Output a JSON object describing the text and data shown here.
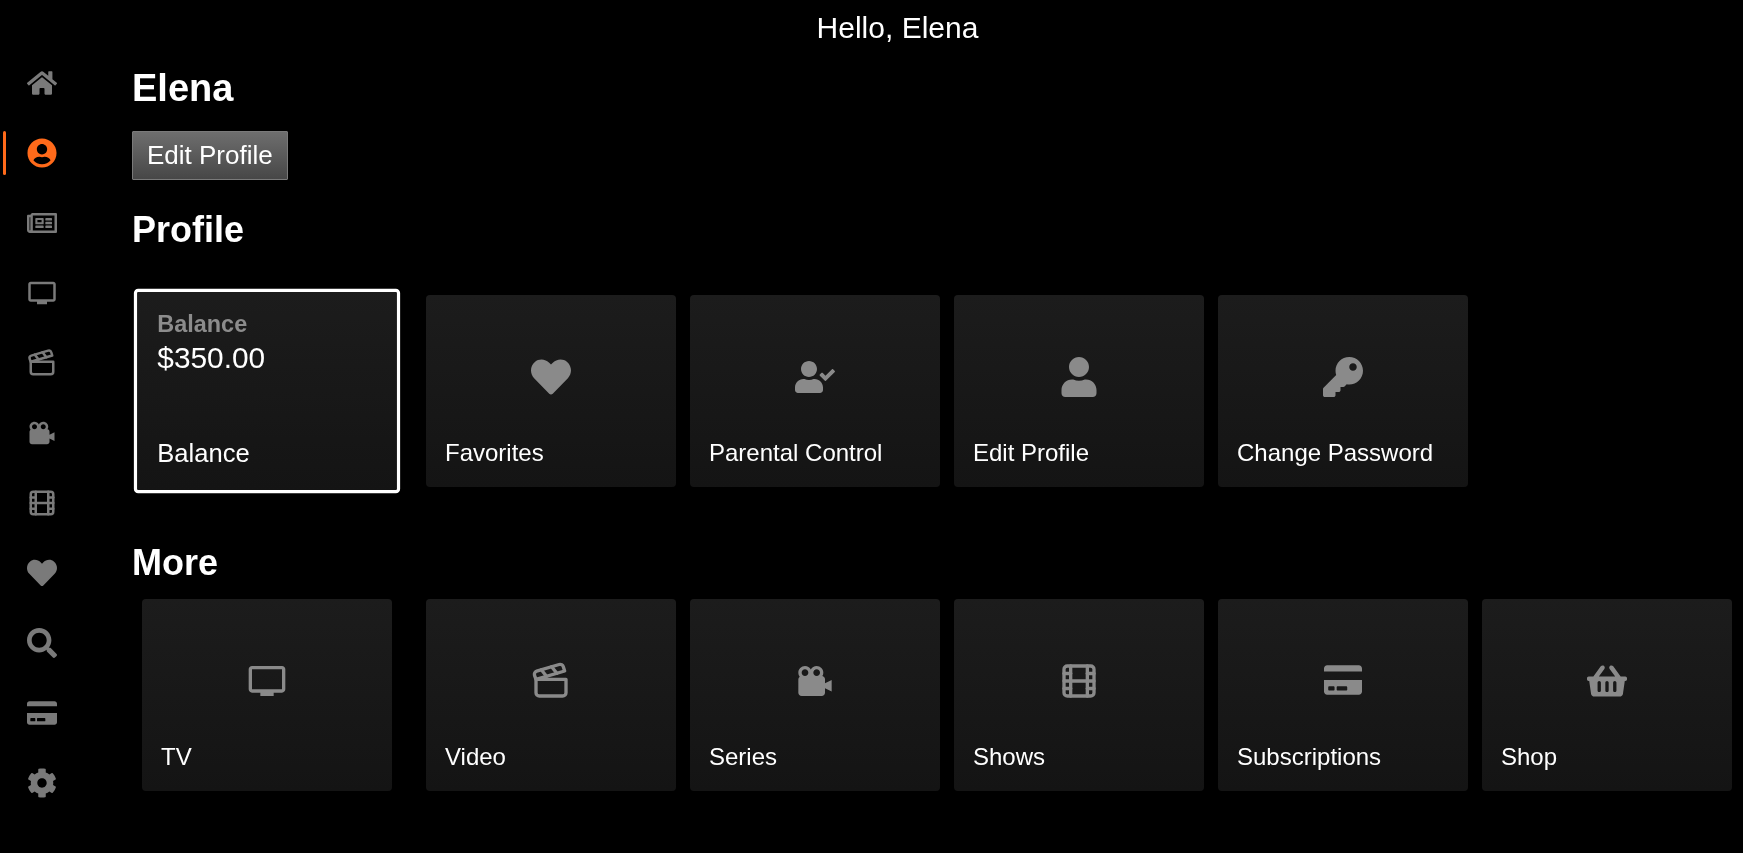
{
  "header": {
    "greeting": "Hello, Elena"
  },
  "sidebar": {
    "items": [
      {
        "selected": false
      },
      {
        "selected": true
      },
      {
        "selected": false
      },
      {
        "selected": false
      },
      {
        "selected": false
      },
      {
        "selected": false
      },
      {
        "selected": false
      },
      {
        "selected": false
      },
      {
        "selected": false
      },
      {
        "selected": false
      },
      {
        "selected": false
      }
    ]
  },
  "user": {
    "name": "Elena",
    "edit_button": "Edit Profile"
  },
  "profile": {
    "title": "Profile",
    "cards": [
      {
        "kind": "balance",
        "label": "Balance",
        "amount": "$350.00",
        "title": "Balance",
        "selected": true
      },
      {
        "kind": "link",
        "title": "Favorites",
        "selected": false
      },
      {
        "kind": "link",
        "title": "Parental Control",
        "selected": false
      },
      {
        "kind": "link",
        "title": "Edit Profile",
        "selected": false
      },
      {
        "kind": "link",
        "title": "Change Password",
        "selected": false
      }
    ]
  },
  "more": {
    "title": "More",
    "cards": [
      {
        "title": "TV",
        "selected": false
      },
      {
        "title": "Video",
        "selected": false
      },
      {
        "title": "Series",
        "selected": false
      },
      {
        "title": "Shows",
        "selected": false
      },
      {
        "title": "Subscriptions",
        "selected": false
      },
      {
        "title": "Shop",
        "selected": false
      }
    ]
  }
}
